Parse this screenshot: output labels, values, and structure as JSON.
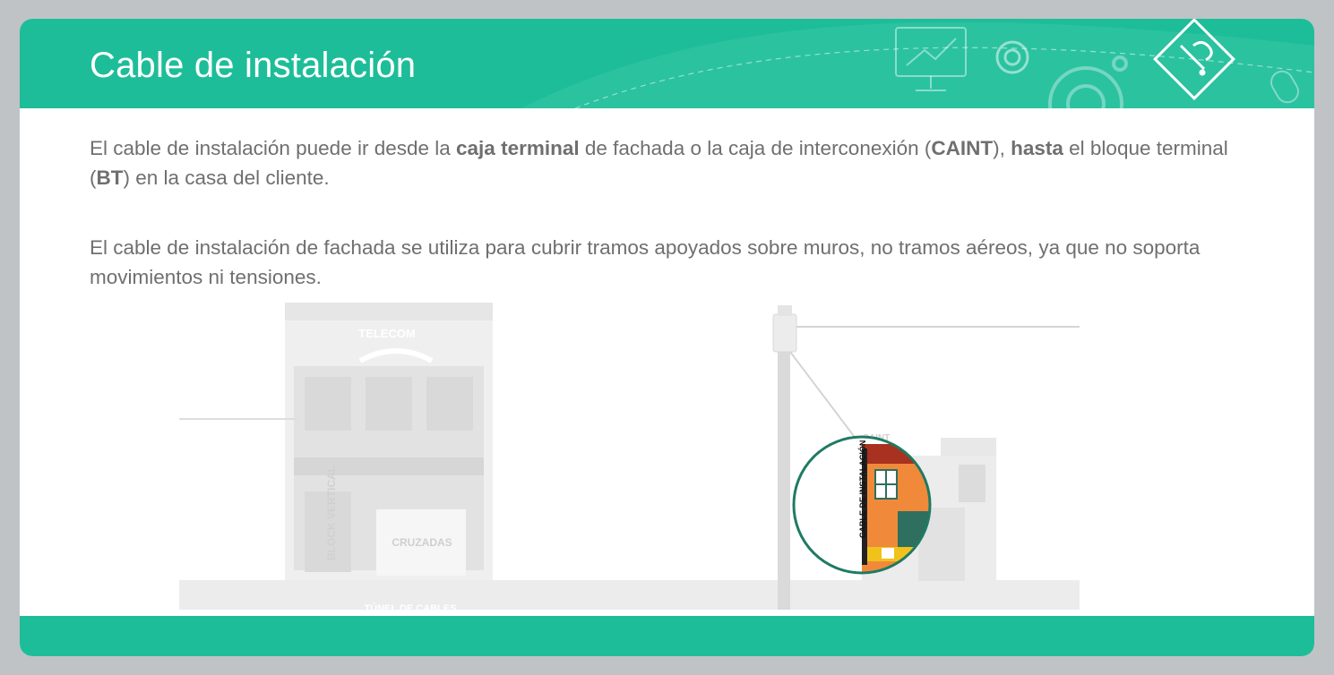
{
  "header": {
    "title": "Cable de instalación",
    "icons": [
      "presentation-board-icon",
      "gear-icon",
      "gears-icon",
      "pencil-question-badge-icon",
      "mouse-icon"
    ]
  },
  "content": {
    "p1": {
      "s1": "El cable de instalación puede ir desde la ",
      "b1": "caja terminal",
      "s2": " de fachada o la caja de interconexión (",
      "b2": "CAINT",
      "s3": "), ",
      "b3": "hasta",
      "s4": " el bloque terminal (",
      "b4": "BT",
      "s5": ") en la casa del cliente."
    },
    "p2": "El cable de instalación de fachada se utiliza para cubrir tramos apoyados sobre muros, no tramos aéreos, ya que no soporta movimientos ni tensiones."
  },
  "illustration": {
    "building_sign": "TELECOM",
    "vertical_block_label": "BLOCK VERTICAL",
    "crossings_label": "CRUZADAS",
    "tunnel_label": "TÚNEL DE CABLES",
    "caint_label": "CAINT",
    "cable_label": "CABLE DE INSTALACIÓN"
  },
  "colors": {
    "accent": "#1ebd99",
    "text": "#6f6f6f",
    "zoom_ring": "#1f7a63",
    "house_orange": "#f08a3a",
    "roof_red": "#a8321f"
  }
}
